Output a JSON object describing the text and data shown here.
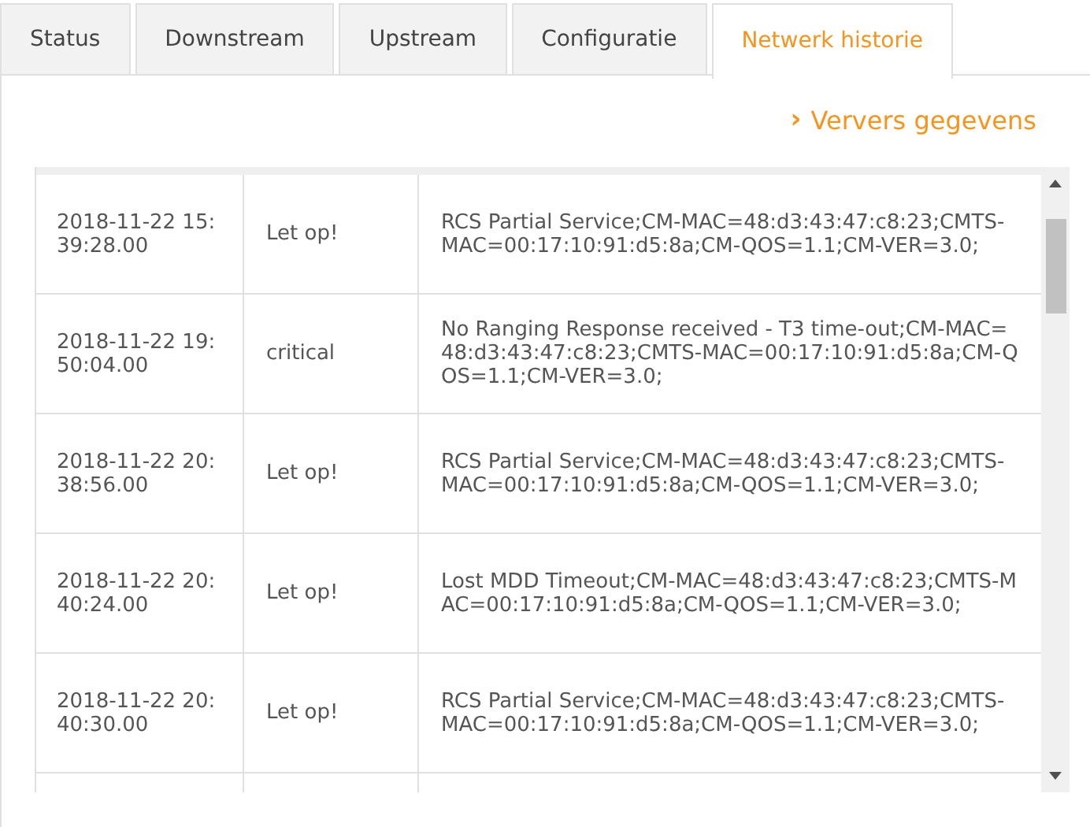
{
  "tabs": [
    {
      "label": "Status",
      "selected": false
    },
    {
      "label": "Downstream",
      "selected": false
    },
    {
      "label": "Upstream",
      "selected": false
    },
    {
      "label": "Configuratie",
      "selected": false
    },
    {
      "label": "Netwerk historie",
      "selected": true
    }
  ],
  "refresh_link": {
    "icon": "›",
    "label": "Ververs gegevens"
  },
  "table": {
    "rows": [
      {
        "time": "2018-11-22 15:39:28.00",
        "priority": "Let op!",
        "description": "RCS Partial Service;CM-MAC=48:d3:43:47:c8:23;CMTS-MAC=00:17:10:91:d5:8a;CM-QOS=1.1;CM-VER=3.0;"
      },
      {
        "time": "2018-11-22 19:50:04.00",
        "priority": "critical",
        "description": "No Ranging Response received - T3 time-out;CM-MAC=48:d3:43:47:c8:23;CMTS-MAC=00:17:10:91:d5:8a;CM-QOS=1.1;CM-VER=3.0;"
      },
      {
        "time": "2018-11-22 20:38:56.00",
        "priority": "Let op!",
        "description": "RCS Partial Service;CM-MAC=48:d3:43:47:c8:23;CMTS-MAC=00:17:10:91:d5:8a;CM-QOS=1.1;CM-VER=3.0;"
      },
      {
        "time": "2018-11-22 20:40:24.00",
        "priority": "Let op!",
        "description": "Lost MDD Timeout;CM-MAC=48:d3:43:47:c8:23;CMTS-MAC=00:17:10:91:d5:8a;CM-QOS=1.1;CM-VER=3.0;"
      },
      {
        "time": "2018-11-22 20:40:30.00",
        "priority": "Let op!",
        "description": "RCS Partial Service;CM-MAC=48:d3:43:47:c8:23;CMTS-MAC=00:17:10:91:d5:8a;CM-QOS=1.1;CM-VER=3.0;"
      }
    ]
  }
}
